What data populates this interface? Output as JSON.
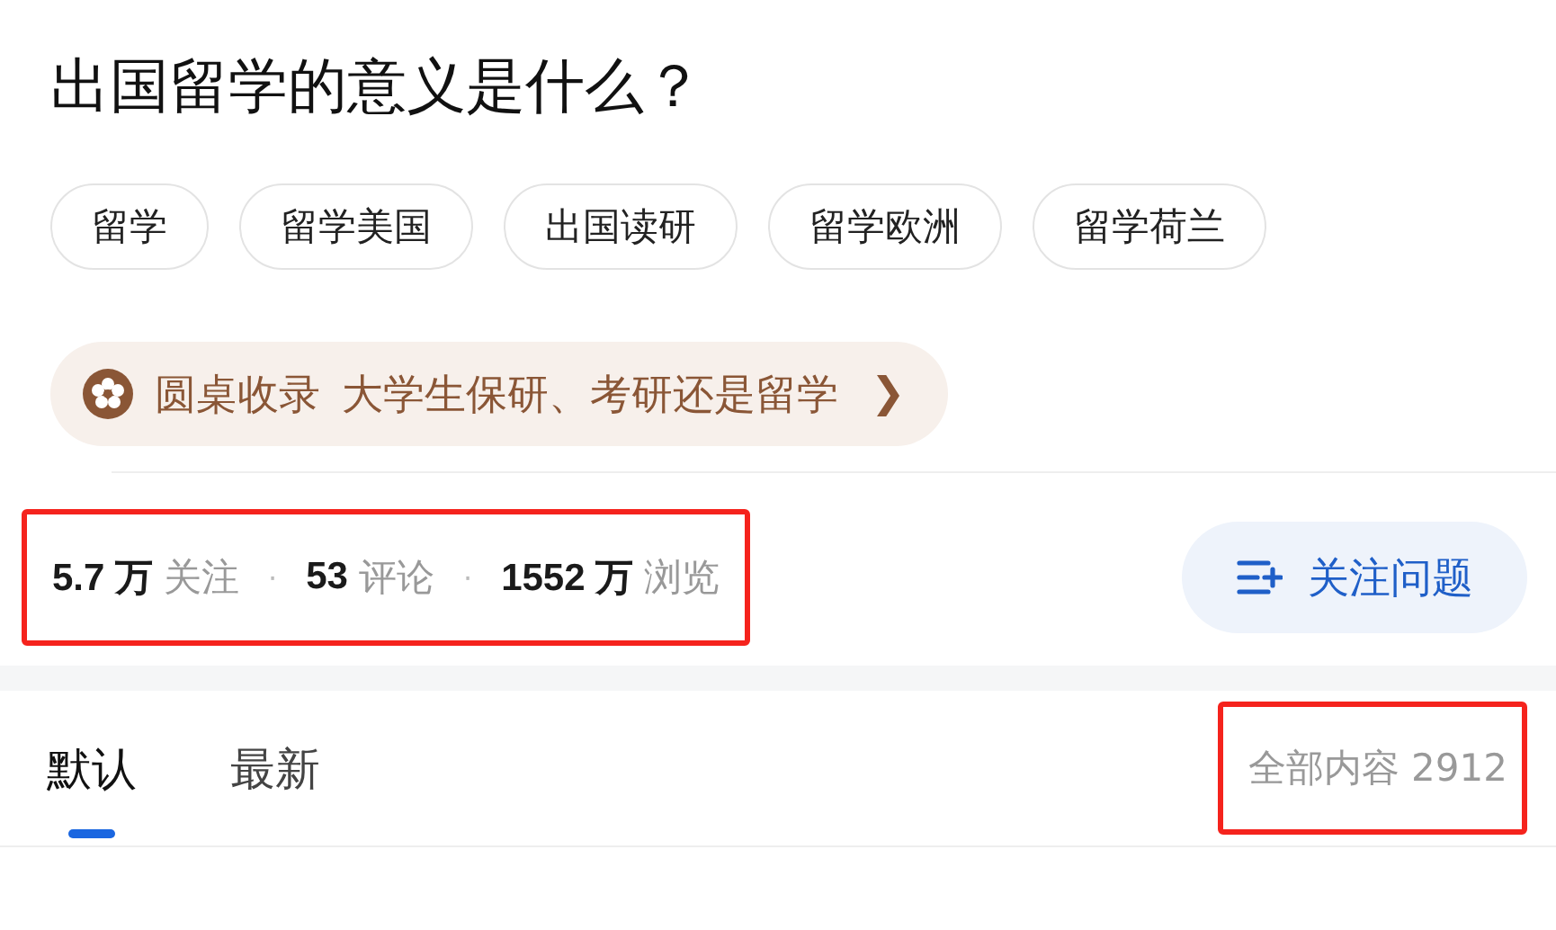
{
  "question": {
    "title": "出国留学的意义是什么？"
  },
  "tags": [
    "留学",
    "留学美国",
    "出国读研",
    "留学欧洲",
    "留学荷兰"
  ],
  "roundtable": {
    "label": "圆桌收录",
    "topic": "大学生保研、考研还是留学",
    "chevron": "❯"
  },
  "stats": {
    "highlighted": true,
    "items": [
      {
        "number": "5.7 万",
        "label": "关注"
      },
      {
        "number": "53",
        "label": "评论"
      },
      {
        "number": "1552 万",
        "label": "浏览"
      }
    ],
    "separator": "·"
  },
  "follow_button": {
    "label": "关注问题"
  },
  "tabs": [
    {
      "label": "默认",
      "selected": true
    },
    {
      "label": "最新",
      "selected": false
    }
  ],
  "content_count": {
    "text": "全部内容 2912",
    "highlighted": true
  }
}
